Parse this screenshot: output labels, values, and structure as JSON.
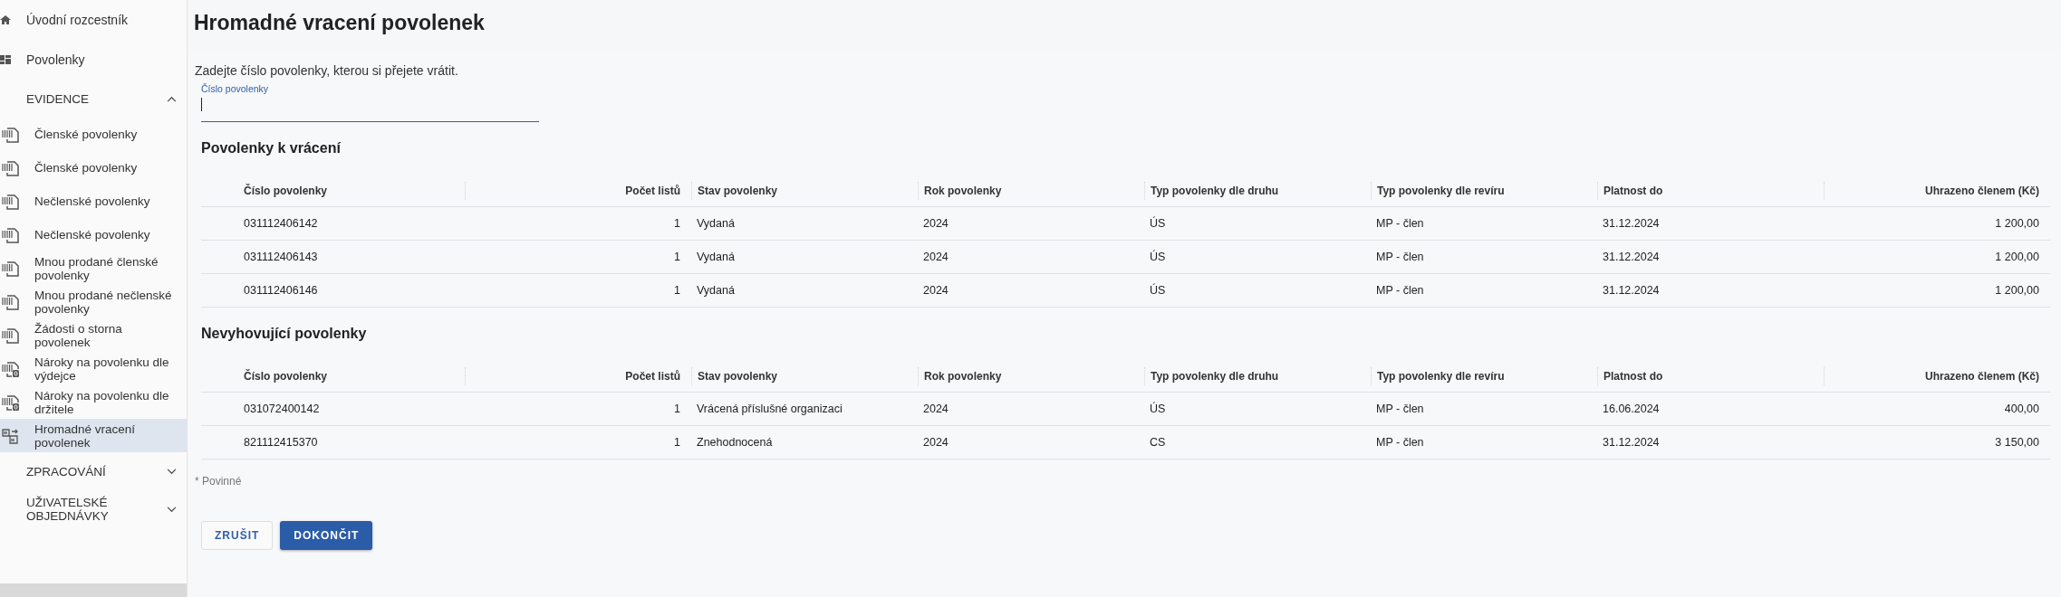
{
  "sidebar": {
    "nav": [
      {
        "label": "Úvodní rozcestník",
        "selected": false
      },
      {
        "label": "Povolenky",
        "selected": false
      }
    ],
    "sections": [
      {
        "label": "EVIDENCE",
        "expanded": true,
        "children": [
          {
            "label": "Členské povolenky",
            "selected": false
          },
          {
            "label": "Členské povolenky",
            "selected": false
          },
          {
            "label": "Nečlenské povolenky",
            "selected": false
          },
          {
            "label": "Nečlenské povolenky",
            "selected": false
          },
          {
            "label": "Mnou prodané členské povolenky",
            "selected": false
          },
          {
            "label": "Mnou prodané nečlenské povolenky",
            "selected": false
          },
          {
            "label": "Žádosti o storna povolenek",
            "selected": false
          },
          {
            "label": "Nároky na povolenku dle výdejce",
            "selected": false
          },
          {
            "label": "Nároky na povolenku dle držitele",
            "selected": false
          },
          {
            "label": "Hromadné vracení povolenek",
            "selected": true
          }
        ]
      },
      {
        "label": "ZPRACOVÁNÍ",
        "expanded": false
      },
      {
        "label": "UŽIVATELSKÉ OBJEDNÁVKY",
        "expanded": false
      }
    ]
  },
  "page": {
    "title": "Hromadné vracení povolenek",
    "instruction": "Zadejte číslo povolenky, kterou si přejete vrátit.",
    "field": {
      "label": "Číslo povolenky",
      "focused": true
    }
  },
  "tables": [
    {
      "title": "Povolenky k vrácení",
      "columns": [
        "Číslo povolenky",
        "Počet listů",
        "Stav povolenky",
        "Rok povolenky",
        "Typ povolenky dle druhu",
        "Typ povolenky dle revíru",
        "Platnost do",
        "Uhrazeno členem (Kč)"
      ],
      "rows": [
        [
          "031112406142",
          "1",
          "Vydaná",
          "2024",
          "ÚS",
          "MP - člen",
          "31.12.2024",
          "1 200,00"
        ],
        [
          "031112406143",
          "1",
          "Vydaná",
          "2024",
          "ÚS",
          "MP - člen",
          "31.12.2024",
          "1 200,00"
        ],
        [
          "031112406146",
          "1",
          "Vydaná",
          "2024",
          "ÚS",
          "MP - člen",
          "31.12.2024",
          "1 200,00"
        ]
      ]
    },
    {
      "title": "Nevyhovující povolenky",
      "columns": [
        "Číslo povolenky",
        "Počet listů",
        "Stav povolenky",
        "Rok povolenky",
        "Typ povolenky dle druhu",
        "Typ povolenky dle revíru",
        "Platnost do",
        "Uhrazeno členem (Kč)"
      ],
      "rows": [
        [
          "031072400142",
          "1",
          "Vrácená příslušné organizaci",
          "2024",
          "ÚS",
          "MP - člen",
          "16.06.2024",
          "400,00"
        ],
        [
          "821112415370",
          "1",
          "Znehodnocená",
          "2024",
          "CS",
          "MP - člen",
          "31.12.2024",
          "3 150,00"
        ]
      ]
    }
  ],
  "required_note": "* Povinné",
  "buttons": [
    {
      "label": "ZRUŠIT",
      "kind": "secondary"
    },
    {
      "label": "DOKONČIT",
      "kind": "primary"
    }
  ]
}
